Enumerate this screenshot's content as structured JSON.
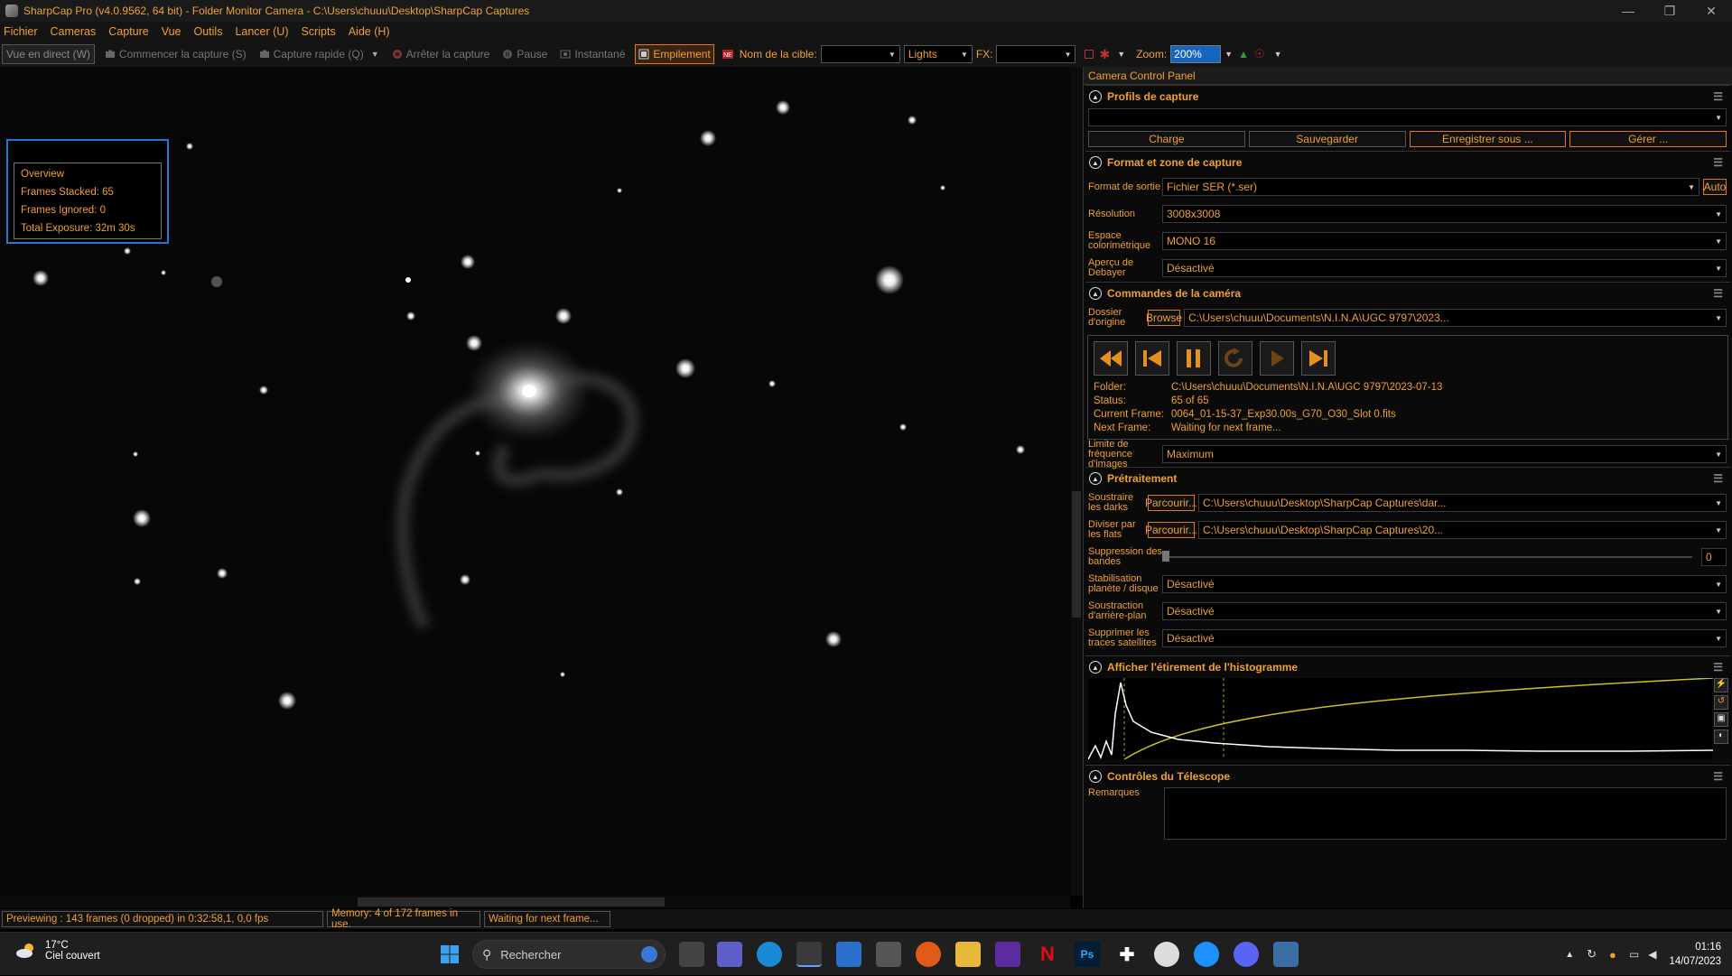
{
  "window": {
    "title": "SharpCap Pro (v4.0.9562, 64 bit) - Folder Monitor Camera - C:\\Users\\chuuu\\Desktop\\SharpCap Captures"
  },
  "menu": [
    "Fichier",
    "Cameras",
    "Capture",
    "Vue",
    "Outils",
    "Lancer (U)",
    "Scripts",
    "Aide (H)"
  ],
  "toolbar": {
    "live": "Vue en direct (W)",
    "start": "Commencer la capture (S)",
    "quick": "Capture rapide (Q)",
    "stop": "Arrêter la capture",
    "pause": "Pause",
    "snapshot": "Instantané",
    "stacking": "Empilement",
    "target_label": "Nom de la cible:",
    "target_value": "",
    "frame_type": "Lights",
    "fx_label": "FX:",
    "fx_value": "",
    "zoom_label": "Zoom:",
    "zoom_value": "200%"
  },
  "overview": {
    "title": "Overview",
    "stacked": "Frames Stacked: 65",
    "ignored": "Frames Ignored: 0",
    "exposure": "Total Exposure:   32m 30s"
  },
  "panel": {
    "title": "Camera Control Panel",
    "profiles": {
      "title": "Profils de capture",
      "value": "",
      "load": "Charge",
      "save": "Sauvegarder",
      "save_as": "Enregistrer sous ...",
      "manage": "Gérer ..."
    },
    "format": {
      "title": "Format et zone de capture",
      "output_label": "Format de sortie",
      "output_value": "Fichier SER (*.ser)",
      "auto": "Auto",
      "res_label": "Résolution",
      "res_value": "3008x3008",
      "color_label": "Espace colorimétrique",
      "color_value": "MONO 16",
      "debayer_label": "Aperçu de Debayer",
      "debayer_value": "Désactivé"
    },
    "camera": {
      "title": "Commandes de la caméra",
      "folder_label": "Dossier d'origine",
      "browse": "Browse",
      "folder_value": "C:\\Users\\chuuu\\Documents\\N.I.N.A\\UGC 9797\\2023...",
      "info": [
        {
          "k": "Folder:",
          "v": "C:\\Users\\chuuu\\Documents\\N.I.N.A\\UGC 9797\\2023-07-13"
        },
        {
          "k": "Status:",
          "v": "65 of 65"
        },
        {
          "k": "Current Frame:",
          "v": "0064_01-15-37_Exp30.00s_G70_O30_Slot 0.fits"
        },
        {
          "k": "Next Frame:",
          "v": "Waiting for next frame..."
        }
      ],
      "rate_label": "Limite de fréquence d'images",
      "rate_value": "Maximum"
    },
    "preproc": {
      "title": "Prétraitement",
      "darks_label": "Soustraire les darks",
      "darks_btn": "Parcourir...",
      "darks_value": "C:\\Users\\chuuu\\Desktop\\SharpCap Captures\\dar...",
      "flats_label": "Diviser par les flats",
      "flats_btn": "Parcourir...",
      "flats_value": "C:\\Users\\chuuu\\Desktop\\SharpCap Captures\\20...",
      "banding_label": "Suppression des bandes",
      "banding_value": "0",
      "stab_label": "Stabilisation planète / disque",
      "stab_value": "Désactivé",
      "bg_label": "Soustraction d'arrière-plan",
      "bg_value": "Désactivé",
      "sat_label": "Supprimer les traces satellites",
      "sat_value": "Désactivé"
    },
    "histogram": {
      "title": "Afficher l'étirement de l'histogramme"
    },
    "telescope": {
      "title": "Contrôles du Télescope",
      "notes_label": "Remarques",
      "notes_value": ""
    }
  },
  "status": {
    "preview": "Previewing : 143 frames (0 dropped) in 0:32:58,1, 0,0 fps",
    "memory": "Memory: 4 of 172 frames in use.",
    "waiting": "Waiting for next frame..."
  },
  "taskbar": {
    "temp": "17°C",
    "weather": "Ciel couvert",
    "search": "Rechercher",
    "time": "01:16",
    "date": "14/07/2023"
  }
}
